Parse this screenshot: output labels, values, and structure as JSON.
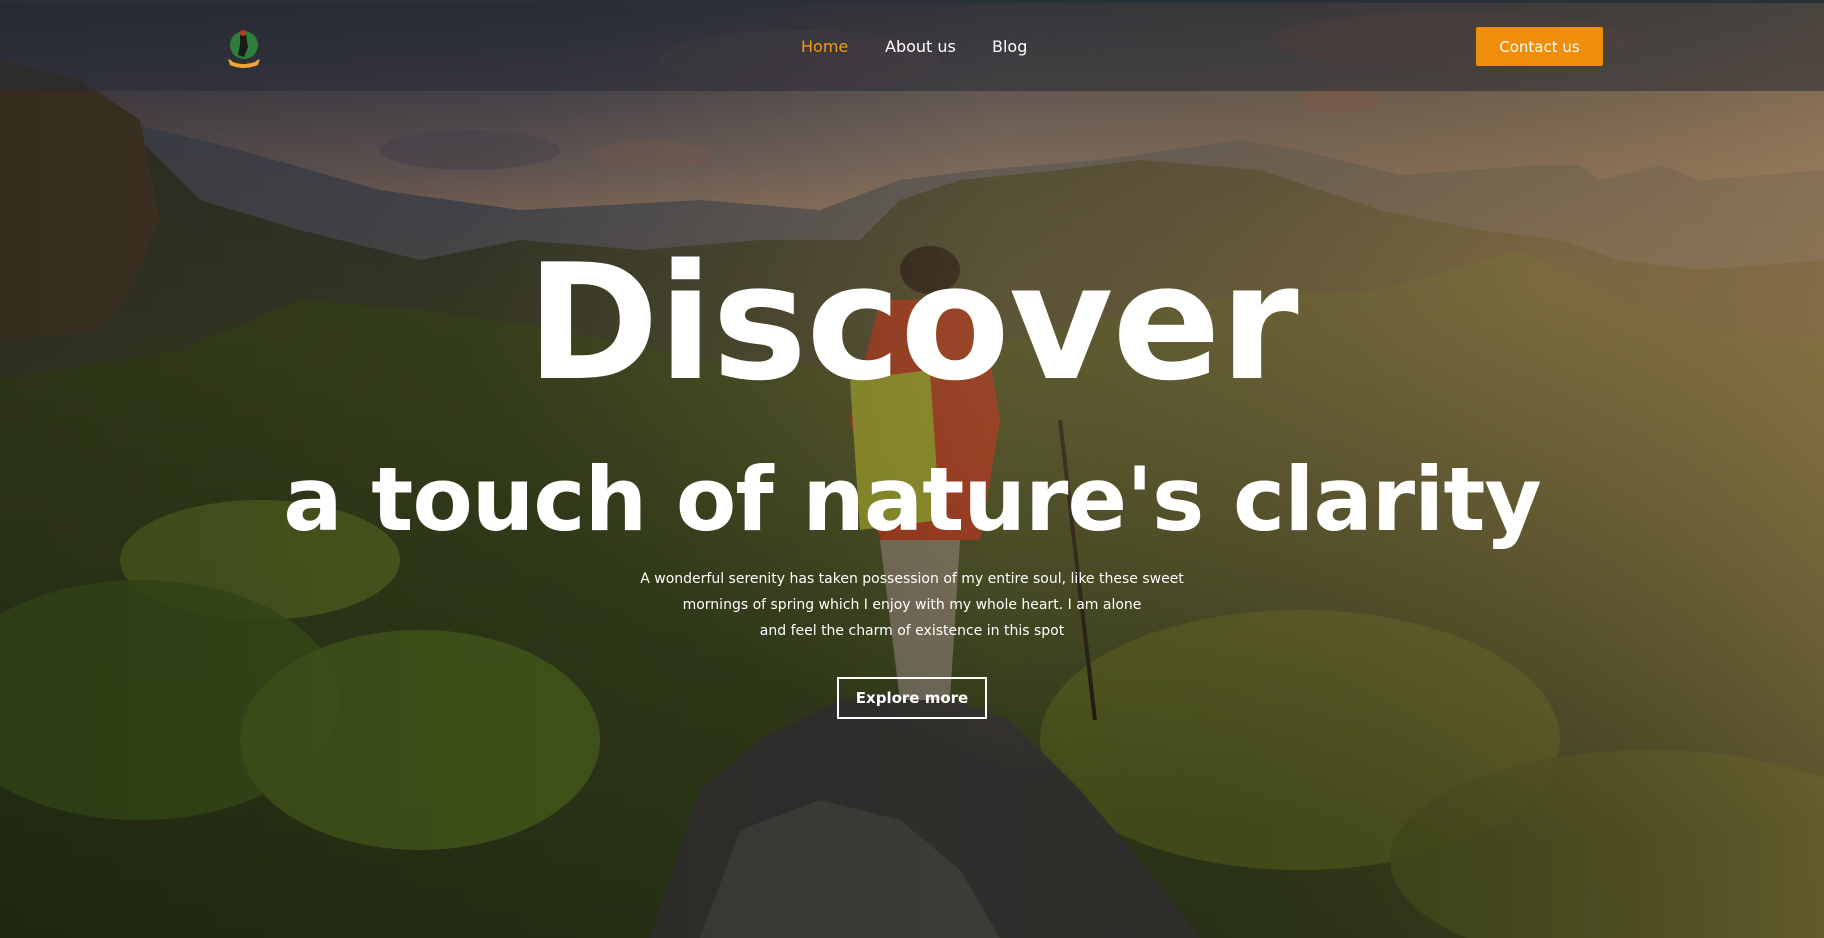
{
  "colors": {
    "accent": "#ee8e0b",
    "nav_active": "#f29a16",
    "header_bg": "rgba(40,44,52,0.55)",
    "text": "#ffffff"
  },
  "header": {
    "logo_icon": "hiker-logo-icon",
    "nav": [
      {
        "label": "Home",
        "active": true
      },
      {
        "label": "About us",
        "active": false
      },
      {
        "label": "Blog",
        "active": false
      }
    ],
    "contact_label": "Contact us"
  },
  "hero": {
    "title": "Discover",
    "subtitle": "a touch of nature's clarity",
    "paragraph_lines": [
      "A wonderful serenity has taken possession of my entire soul, like these sweet",
      "mornings of spring which I enjoy with my whole heart. I am alone",
      "and feel the charm of existence in this spot"
    ],
    "cta_label": "Explore more",
    "background_image": "hiker-on-mountain-at-sunset"
  }
}
